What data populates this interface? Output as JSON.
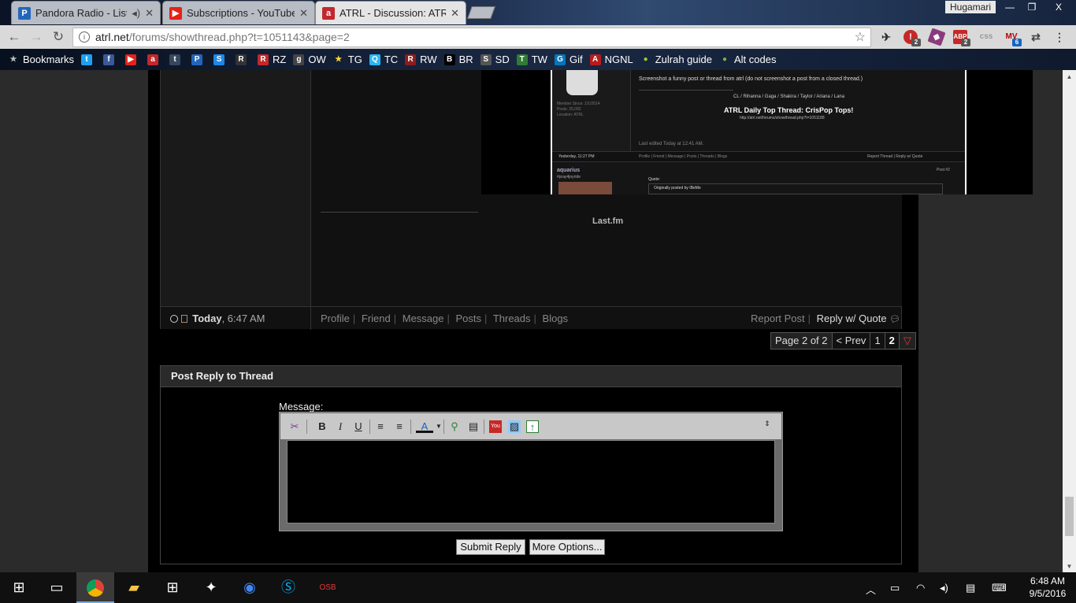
{
  "tabs": [
    {
      "title": "Pandora Radio - Listen",
      "icon": "P"
    },
    {
      "title": "Subscriptions - YouTube",
      "icon": "▶"
    },
    {
      "title": "ATRL - Discussion: ATRL",
      "icon": "a"
    }
  ],
  "window": {
    "user": "Hugamari",
    "minimize": "—",
    "restore": "❐",
    "close": "X"
  },
  "toolbar": {
    "url_host": "atrl.net",
    "url_path": "/forums/showthread.php?t=1051143&page=2",
    "ext_badges": [
      "2",
      "2",
      "6"
    ],
    "ext_css": "css"
  },
  "bookmarks": [
    {
      "label": "Bookmarks",
      "icon": "★"
    },
    {
      "label": "",
      "icon": "t"
    },
    {
      "label": "",
      "icon": "f"
    },
    {
      "label": "",
      "icon": "▶"
    },
    {
      "label": "",
      "icon": "a"
    },
    {
      "label": "",
      "icon": "t"
    },
    {
      "label": "",
      "icon": "P"
    },
    {
      "label": "",
      "icon": "S"
    },
    {
      "label": "",
      "icon": "R"
    },
    {
      "label": "RZ",
      "icon": "R"
    },
    {
      "label": "OW",
      "icon": "g"
    },
    {
      "label": "TG",
      "icon": "★"
    },
    {
      "label": "TC",
      "icon": "Q"
    },
    {
      "label": "RW",
      "icon": "R"
    },
    {
      "label": "BR",
      "icon": "B"
    },
    {
      "label": "SD",
      "icon": "S"
    },
    {
      "label": "TW",
      "icon": "T"
    },
    {
      "label": "Gif",
      "icon": "G"
    },
    {
      "label": "NGNL",
      "icon": "A"
    },
    {
      "label": "Zulrah guide",
      "icon": "●"
    },
    {
      "label": "Alt codes",
      "icon": "●"
    }
  ],
  "screenshot_in_post": {
    "line1": "Screenshot a funny post or thread from atrl (do not screenshot a post from a closed thread.)",
    "line2": "CL / Rihanna / Gaga / Shakira / Taylor / Ariana / Lana",
    "headline": "ATRL Daily Top Thread: CrisPop Tops!",
    "link": "http://atrl.net/forums/showthread.php?t=1051188",
    "member_since": "Member Since: 1/1/2014",
    "posts": "Posts: 25,092",
    "location": "Location: ATRL",
    "edited": "Last edited Today at 12:41 AM.",
    "foot_date": "Yesterday, 11:27 PM",
    "foot_links": "Profile | Friend | Message | Posts | Threads | Blogs",
    "foot_right": "Report Thread | Reply w/ Quote",
    "user2": "aquarius",
    "user2_tag": "#pray4joyride",
    "post_num": "Post #2",
    "quote_label": "Quote:",
    "quote_by": "Originally posted by IBeMe"
  },
  "signature": {
    "lastfm": "Last.fm"
  },
  "post_footer": {
    "date_bold": "Today",
    "time": ", 6:47 AM",
    "links": [
      "Profile",
      "Friend",
      "Message",
      "Posts",
      "Threads",
      "Blogs"
    ],
    "report": "Report Post",
    "reply_quote": "Reply w/ Quote"
  },
  "pager": {
    "label": "Page 2 of 2",
    "prev": "< Prev",
    "p1": "1",
    "p2": "2",
    "menu": "▽"
  },
  "reply": {
    "heading": "Post Reply to Thread",
    "message_label": "Message:",
    "submit": "Submit Reply",
    "more": "More Options..."
  },
  "taskbar": {
    "time": "6:48 AM",
    "date": "9/5/2016"
  }
}
